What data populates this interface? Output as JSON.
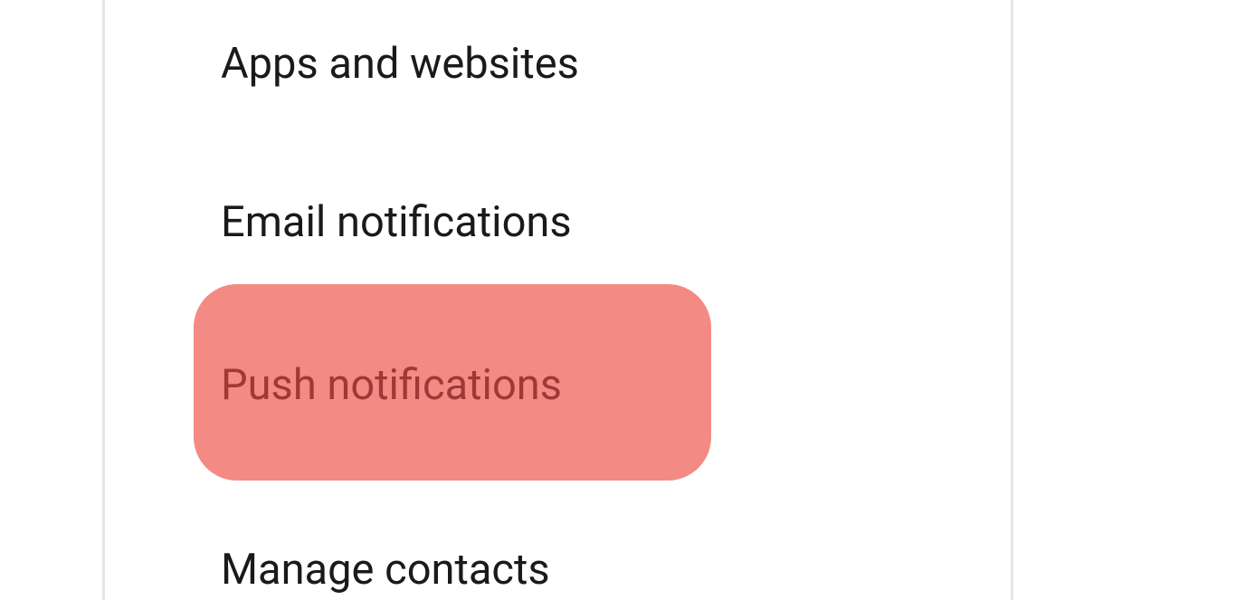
{
  "settings_menu": {
    "items": [
      {
        "label": "Apps and websites"
      },
      {
        "label": "Email notifications"
      },
      {
        "label": "Push notifications"
      },
      {
        "label": "Manage contacts"
      }
    ]
  },
  "highlight": {
    "target_index": 2,
    "color": "#f48a84"
  }
}
